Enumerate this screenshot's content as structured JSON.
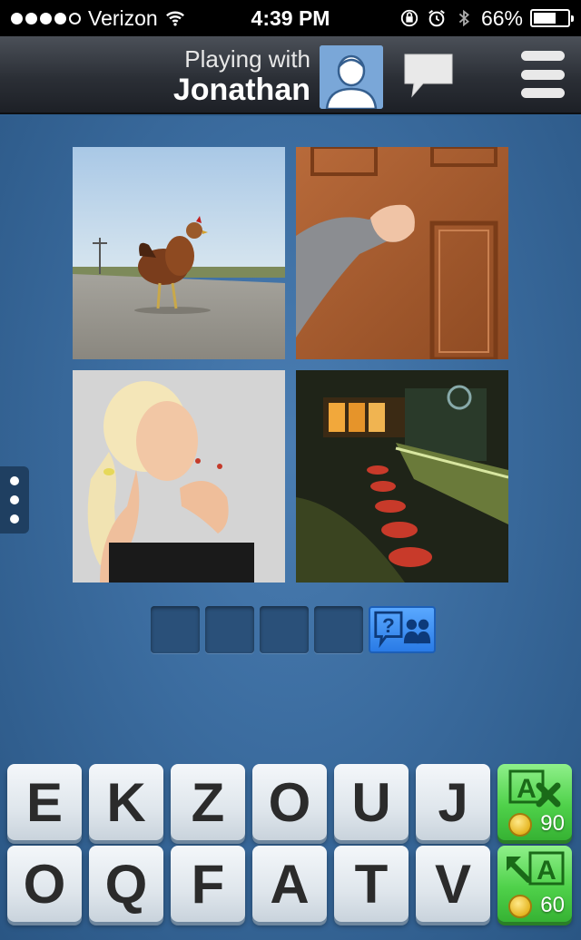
{
  "status_bar": {
    "carrier": "Verizon",
    "time": "4:39 PM",
    "battery": "66%",
    "battery_level": 0.66,
    "signal_bars": 4
  },
  "header": {
    "subtitle": "Playing with",
    "name": "Jonathan",
    "avatar_icon": "person-avatar-icon",
    "chat_icon": "chat-bubble-icon",
    "menu_icon": "hamburger-menu-icon"
  },
  "puzzle": {
    "images": [
      {
        "subject": "chicken crossing road"
      },
      {
        "subject": "hand knocking on door"
      },
      {
        "subject": "woman thinking"
      },
      {
        "subject": "bar with stools"
      }
    ],
    "answer_slots": 4,
    "hint_icon": "ask-friends-icon"
  },
  "keyboard": {
    "row1": [
      "E",
      "K",
      "Z",
      "O",
      "U",
      "J"
    ],
    "row2": [
      "O",
      "Q",
      "F",
      "A",
      "T",
      "V"
    ],
    "powerups": [
      {
        "name": "remove-letters",
        "icon": "remove-letter-icon",
        "cost": "90"
      },
      {
        "name": "reveal-letter",
        "icon": "reveal-letter-icon",
        "cost": "60"
      }
    ]
  },
  "colors": {
    "background": "#3b6c9f",
    "powerup_green": "#4fd14a",
    "hint_blue": "#2a7be6"
  }
}
